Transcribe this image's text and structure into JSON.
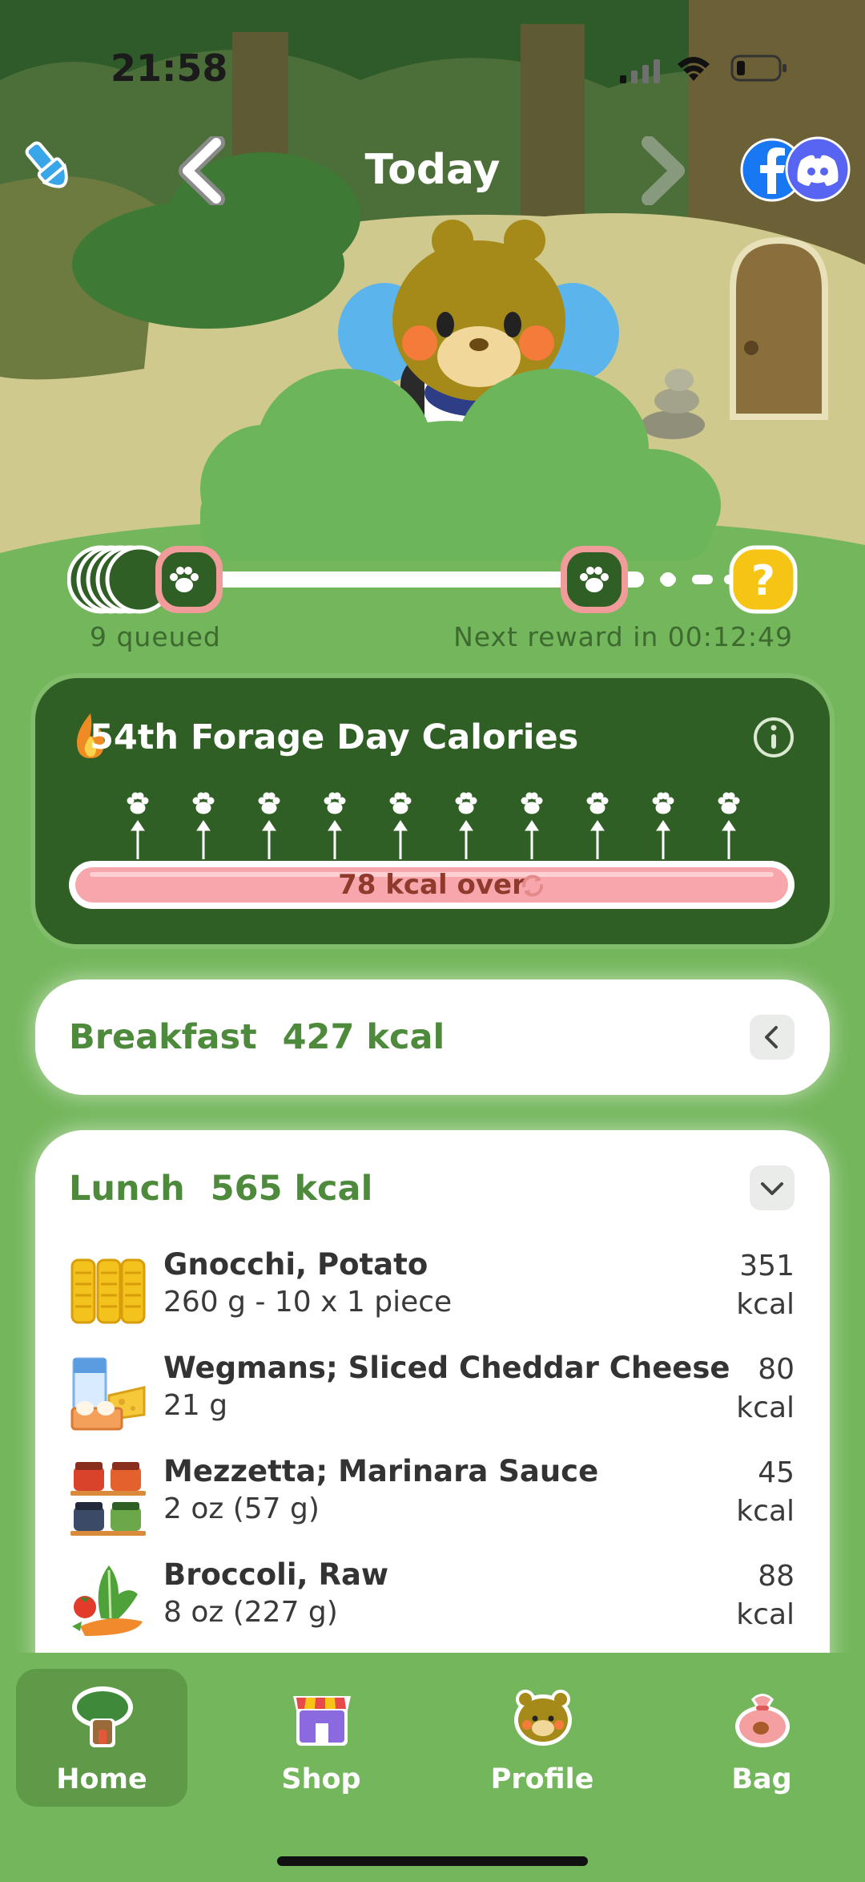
{
  "status": {
    "time": "21:58"
  },
  "nav": {
    "title": "Today"
  },
  "pet_bar": {
    "queued_label": "9 queued",
    "reward_label": "Next reward in 00:12:49"
  },
  "calories": {
    "title": "54th Forage Day Calories",
    "status": "78 kcal over"
  },
  "meals": {
    "breakfast": {
      "name": "Breakfast",
      "kcal": "427 kcal"
    },
    "lunch": {
      "name": "Lunch",
      "kcal": "565 kcal",
      "items": [
        {
          "name": "Gnocchi, Potato",
          "amount": "260 g - 10 x 1 piece",
          "kcal_value": "351",
          "kcal_unit": "kcal",
          "icon": "gnocchi-icon"
        },
        {
          "name": "Wegmans; Sliced Cheddar Cheese",
          "amount": "21 g",
          "kcal_value": "80",
          "kcal_unit": "kcal",
          "icon": "dairy-icon"
        },
        {
          "name": "Mezzetta; Marinara Sauce",
          "amount": "2 oz (57 g)",
          "kcal_value": "45",
          "kcal_unit": "kcal",
          "icon": "jars-icon"
        },
        {
          "name": "Broccoli, Raw",
          "amount": "8 oz (227 g)",
          "kcal_value": "88",
          "kcal_unit": "kcal",
          "icon": "vegetables-icon"
        }
      ]
    }
  },
  "tabs": [
    {
      "label": "Home",
      "icon": "tree-house-icon",
      "active": true
    },
    {
      "label": "Shop",
      "icon": "shop-icon",
      "active": false
    },
    {
      "label": "Profile",
      "icon": "bear-icon",
      "active": false
    },
    {
      "label": "Bag",
      "icon": "bag-icon",
      "active": false
    }
  ],
  "colors": {
    "accent_green": "#4d8a3c",
    "dark_green": "#2f5f24",
    "background": "#74b65c",
    "over_pink": "#f7a7ab",
    "reward_yellow": "#f6c415"
  }
}
